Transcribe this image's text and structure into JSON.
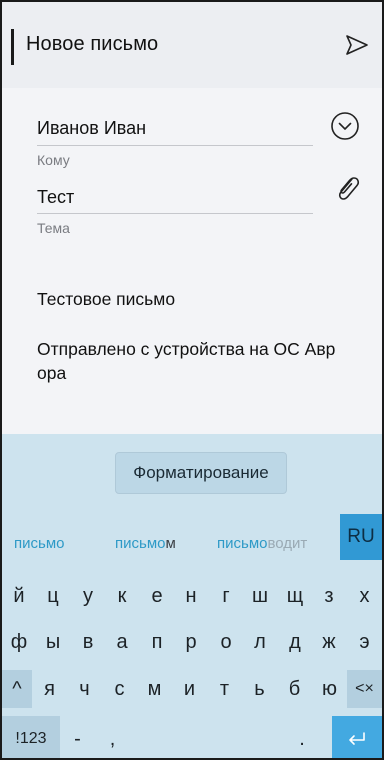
{
  "header": {
    "title": "Новое письмо"
  },
  "form": {
    "to_value": "Иванов Иван",
    "to_label": "Кому",
    "subject_value": "Тест",
    "subject_label": "Тема",
    "body_line1": "Тестовое письмо",
    "body_line2": "Отправлено с устройства на ОС Авр",
    "body_line3": "ора"
  },
  "keyboard": {
    "format_label": "Форматирование",
    "suggestions": [
      {
        "prefix": "письмо",
        "suffix": ""
      },
      {
        "prefix": "письмо",
        "suffix": "м"
      },
      {
        "prefix": "письмо",
        "suffix": "водит"
      }
    ],
    "language": "RU",
    "row1": [
      "й",
      "ц",
      "у",
      "к",
      "е",
      "н",
      "г",
      "ш",
      "щ",
      "з",
      "х"
    ],
    "row2": [
      "ф",
      "ы",
      "в",
      "а",
      "п",
      "р",
      "о",
      "л",
      "д",
      "ж",
      "э"
    ],
    "row3": [
      "я",
      "ч",
      "с",
      "м",
      "и",
      "т",
      "ь",
      "б",
      "ю"
    ],
    "shift_symbol": "^",
    "backspace_symbol": "<×",
    "numbers_label": "!123",
    "dash_key": "-",
    "comma_key": ",",
    "period_key": "."
  },
  "colors": {
    "keyboard_bg": "#cde3ee",
    "accent": "#3199d4",
    "suggestion_highlight": "#2e9ac7"
  }
}
